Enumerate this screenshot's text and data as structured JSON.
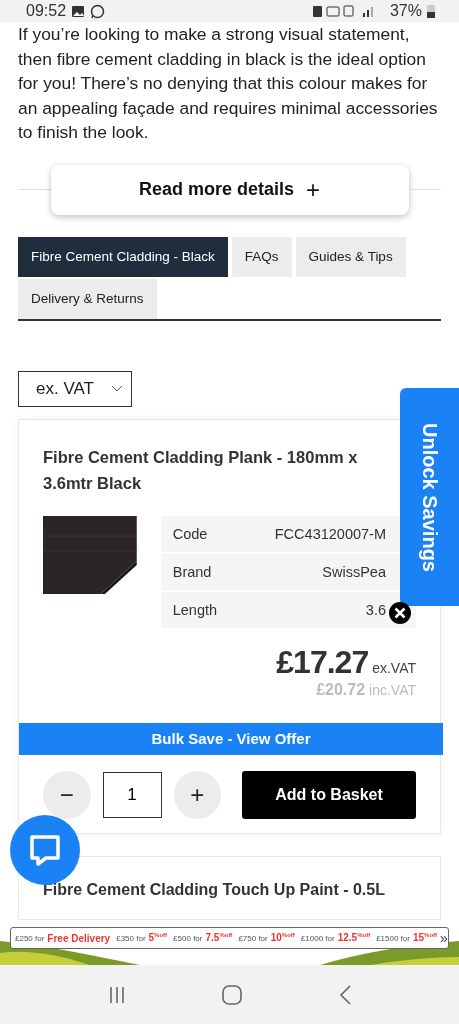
{
  "status_bar": {
    "time": "09:52",
    "battery": "37%"
  },
  "intro_text": "If you’re looking to make a strong visual statement, then fibre cement cladding in black is the ideal option for you! There’s no denying that this colour makes for an appealing façade and requires minimal accessories to finish the look.",
  "read_more_button": {
    "label": "Read more details",
    "icon": "+"
  },
  "tabs": [
    {
      "label": "Fibre Cement Cladding - Black",
      "selected": true
    },
    {
      "label": "FAQs",
      "selected": false
    },
    {
      "label": "Guides & Tips",
      "selected": false
    },
    {
      "label": "Delivery & Returns",
      "selected": false
    }
  ],
  "price_mode_select": {
    "value": "ex. VAT"
  },
  "product": {
    "title": "Fibre Cement Cladding Plank - 180mm x 3.6mtr Black",
    "specs": [
      {
        "label": "Code",
        "value": "FCC43120007-M"
      },
      {
        "label": "Brand",
        "value": "SwissPea"
      },
      {
        "label": "Length",
        "value": "3.6"
      }
    ],
    "price": "£17.27",
    "price_suffix": "ex.VAT",
    "price_inc": "£20.72",
    "price_inc_suffix": "inc.VAT",
    "bulk_save": "Bulk Save - View Offer",
    "decrease": "−",
    "quantity": "1",
    "increase": "+",
    "add_button": "Add to Basket"
  },
  "next_product": {
    "title": "Fibre Cement Cladding Touch Up Paint - 0.5L"
  },
  "unlock_savings": "Unlock Savings",
  "promo_banner": {
    "items": [
      {
        "threshold": "£250 for",
        "reward": "Free Delivery"
      },
      {
        "threshold": "£350 for",
        "reward": "5$^{%off}$"
      },
      {
        "threshold": "£500 for",
        "reward": "7.5$^{%off}$"
      },
      {
        "threshold": "£750 for",
        "reward": "10$^{%off}$"
      },
      {
        "threshold": "£1000 for",
        "reward": "12.5$^{%off}$"
      },
      {
        "threshold": "£1500 for",
        "reward": "15$^{%off}$"
      }
    ],
    "more": "»"
  }
}
